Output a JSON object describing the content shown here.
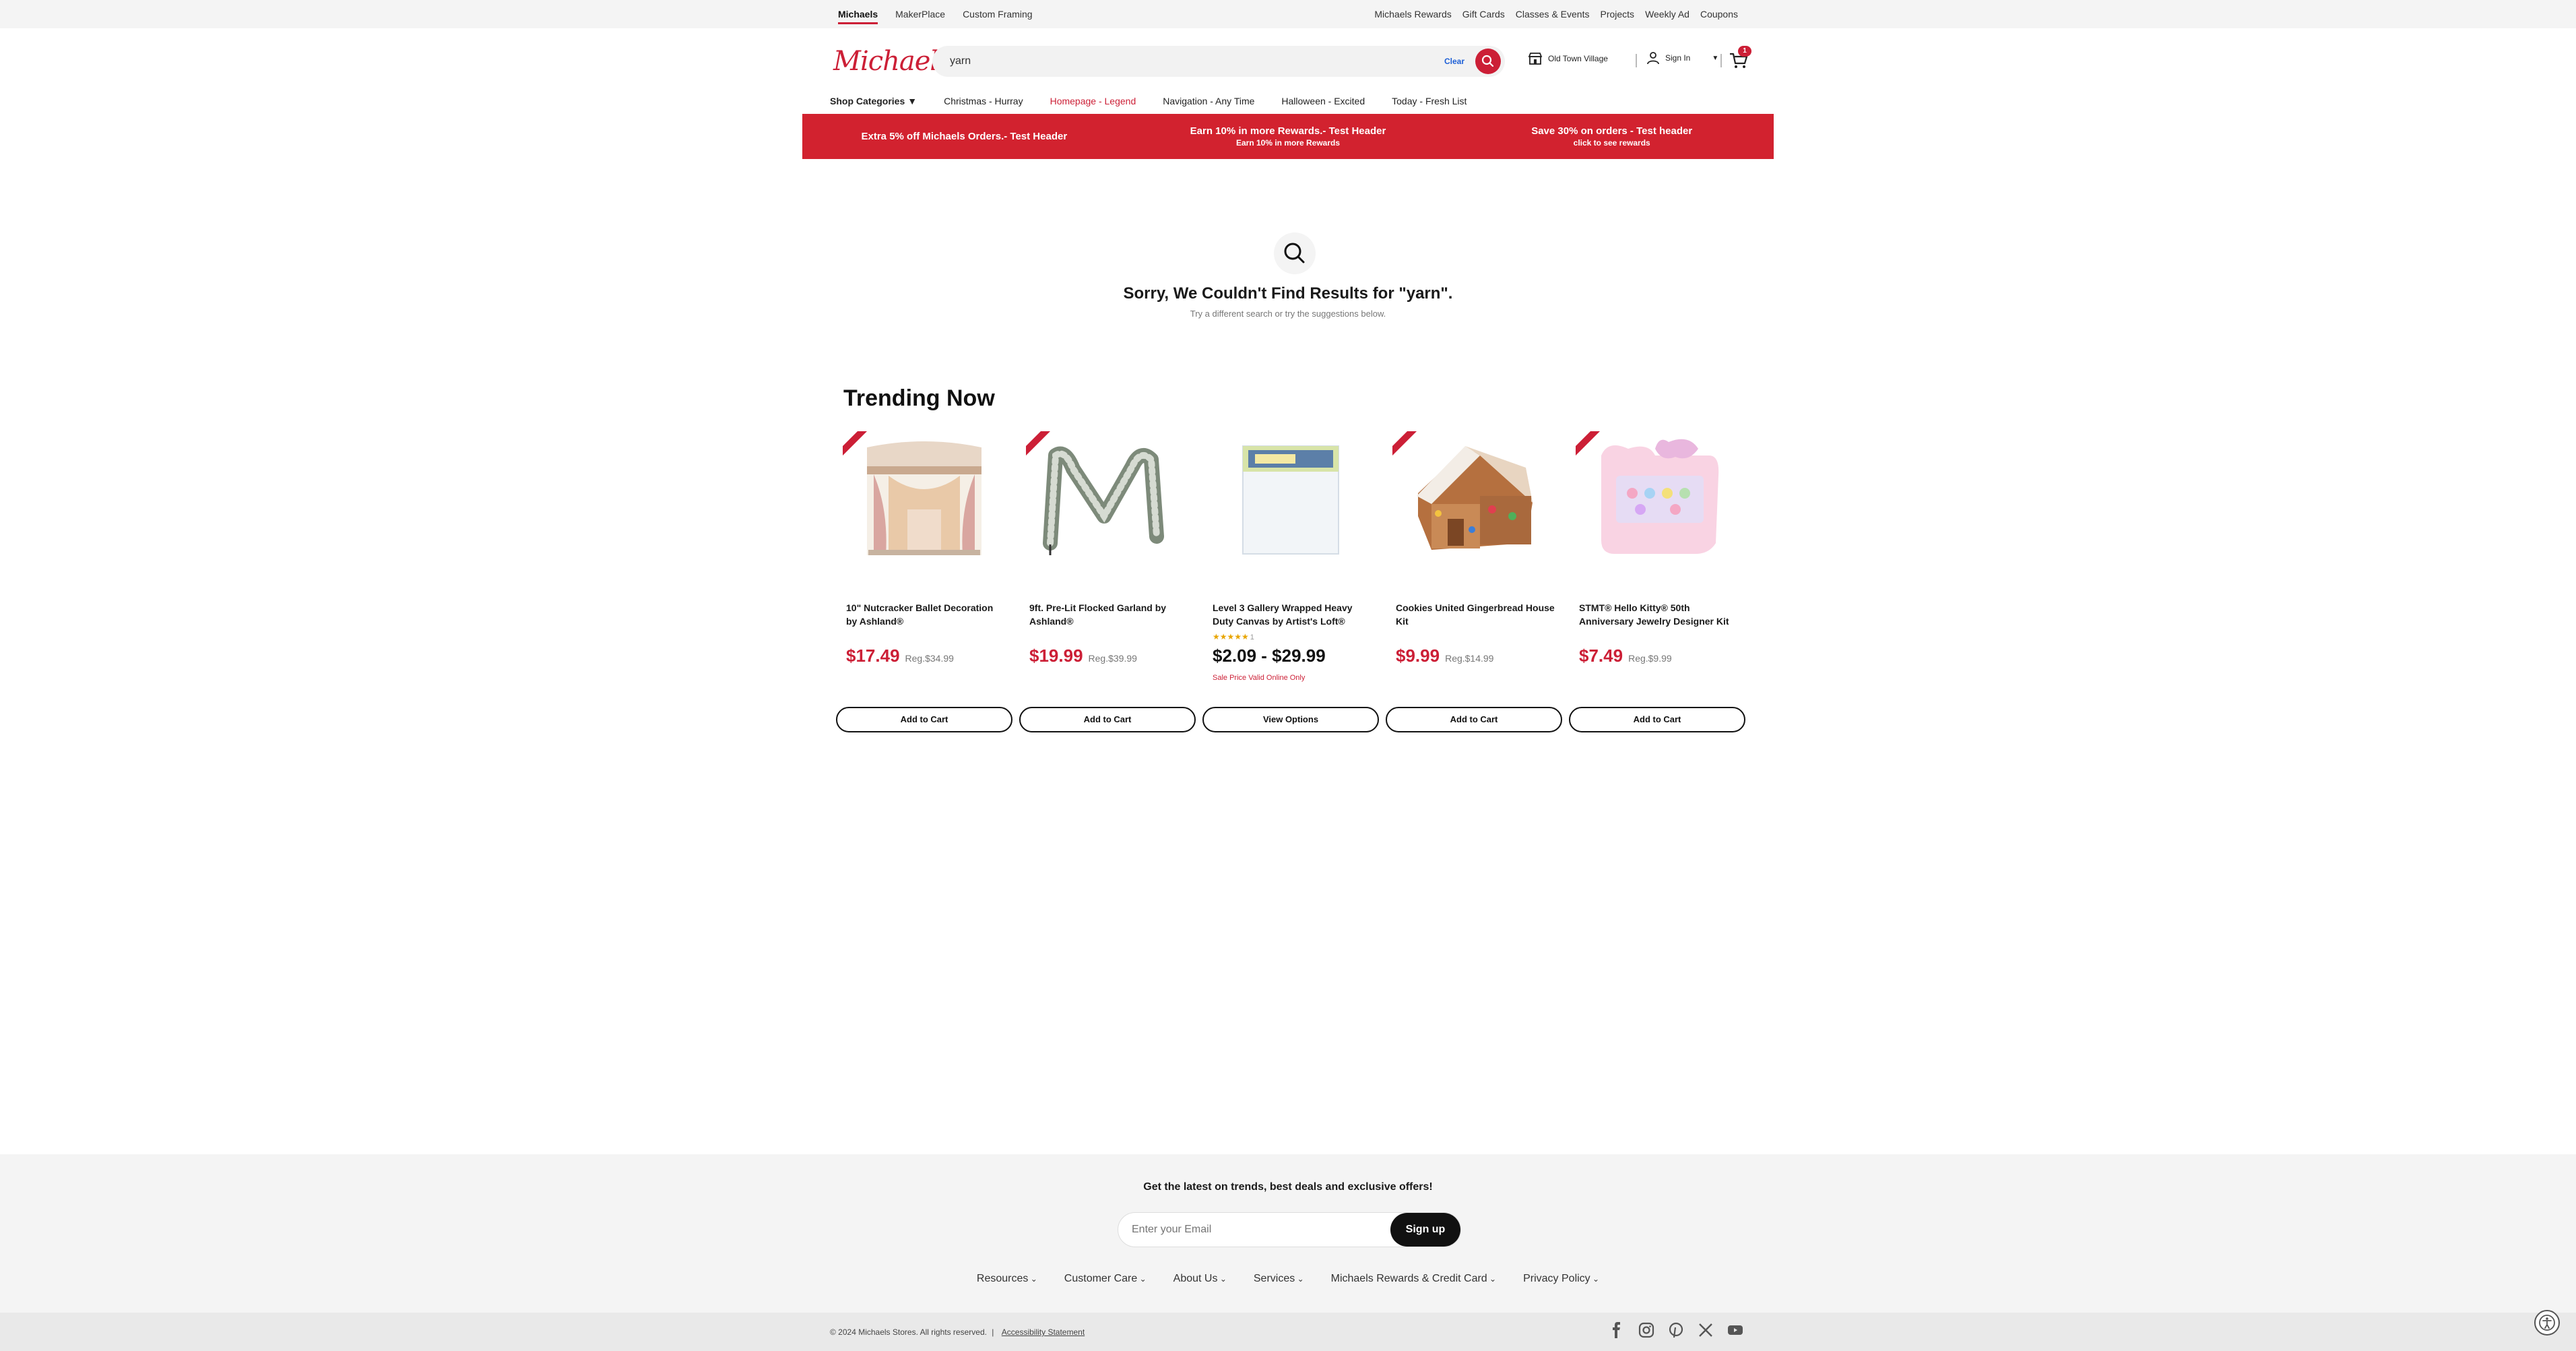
{
  "utility": {
    "left": [
      "Michaels",
      "MakerPlace",
      "Custom Framing"
    ],
    "right": [
      "Michaels Rewards",
      "Gift Cards",
      "Classes & Events",
      "Projects",
      "Weekly Ad",
      "Coupons"
    ]
  },
  "header": {
    "logo": "Michaels",
    "search_value": "yarn",
    "clear_label": "Clear",
    "store": "Old Town Village",
    "signin": "Sign In",
    "cart_count": "1"
  },
  "catnav": [
    "Shop Categories",
    "Christmas - Hurray",
    "Homepage - Legend",
    "Navigation - Any Time",
    "Halloween - Excited",
    "Today - Fresh List"
  ],
  "promo": [
    {
      "title": "Extra 5% off Michaels Orders.- Test Header",
      "sub": ""
    },
    {
      "title": "Earn 10% in more Rewards.- Test Header",
      "sub": "Earn 10% in more Rewards"
    },
    {
      "title": "Save 30% on orders - Test header",
      "sub": "click to see rewards"
    }
  ],
  "no_results": {
    "title": "Sorry, We Couldn't Find Results for \"yarn\".",
    "subtitle": "Try a different search or try the suggestions below."
  },
  "trending": {
    "title": "Trending Now",
    "products": [
      {
        "name": "10\" Nutcracker Ballet Decoration by Ashland®",
        "price": "$17.49",
        "reg": "Reg.$34.99",
        "button": "Add to Cart"
      },
      {
        "name": "9ft. Pre-Lit Flocked Garland by Ashland®",
        "price": "$19.99",
        "reg": "Reg.$39.99",
        "button": "Add to Cart"
      },
      {
        "name": "Level 3 Gallery Wrapped Heavy Duty Canvas by Artist's Loft®",
        "price": "$2.09 - $29.99",
        "reg": "",
        "rating_count": "1",
        "note": "Sale Price Valid Online Only",
        "button": "View Options"
      },
      {
        "name": "Cookies United Gingerbread House Kit",
        "price": "$9.99",
        "reg": "Reg.$14.99",
        "button": "Add to Cart"
      },
      {
        "name": "STMT® Hello Kitty® 50th Anniversary Jewelry Designer Kit",
        "price": "$7.49",
        "reg": "Reg.$9.99",
        "button": "Add to Cart"
      }
    ]
  },
  "footer": {
    "newsletter": "Get the latest on trends, best deals and exclusive offers!",
    "email_placeholder": "Enter your Email",
    "signup": "Sign up",
    "links": [
      "Resources",
      "Customer Care",
      "About Us",
      "Services",
      "Michaels Rewards & Credit Card",
      "Privacy Policy"
    ],
    "copyright": "© 2024 Michaels Stores. All rights reserved.",
    "accessibility": "Accessibility Statement",
    "social_icons": [
      "facebook-icon",
      "instagram-icon",
      "pinterest-icon",
      "x-icon",
      "youtube-icon"
    ]
  },
  "colors": {
    "brand_red": "#cc1f36",
    "promo_red": "#d2222f",
    "link_blue": "#1d5fd6"
  }
}
